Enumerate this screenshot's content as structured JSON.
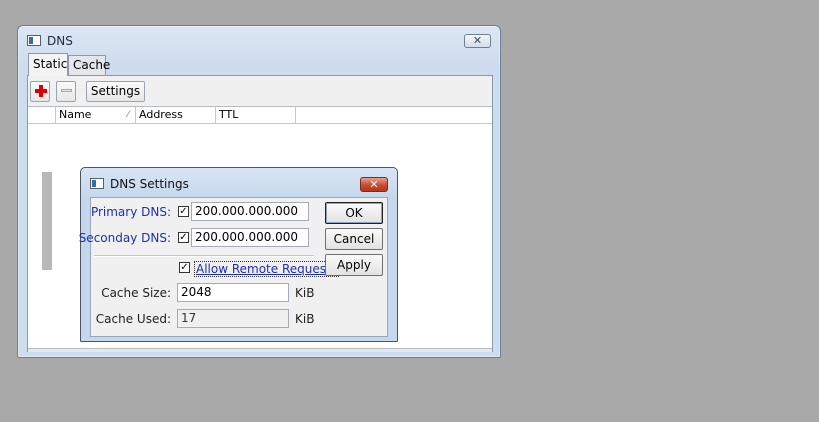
{
  "window": {
    "title": "DNS",
    "close_glyph": "✕",
    "tabs": [
      {
        "label": "Static"
      },
      {
        "label": "Cache"
      }
    ],
    "toolbar": {
      "add_icon": "plus-icon",
      "remove_icon": "minus-icon",
      "settings_label": "Settings"
    },
    "columns": [
      "Name",
      "Address",
      "TTL"
    ]
  },
  "dialog": {
    "title": "DNS Settings",
    "close_glyph": "✕",
    "primary_dns": {
      "label": "Primary DNS:",
      "value": "200.000.000.000",
      "checked": true
    },
    "secondary_dns": {
      "label": "Seconday DNS:",
      "value": "200.000.000.000",
      "checked": true
    },
    "allow_remote": {
      "label": "Allow Remote Requests",
      "checked": true
    },
    "cache_size": {
      "label": "Cache Size:",
      "value": "2048",
      "unit": "KiB"
    },
    "cache_used": {
      "label": "Cache Used:",
      "value": "17",
      "unit": "KiB"
    },
    "buttons": {
      "ok": "OK",
      "cancel": "Cancel",
      "apply": "Apply"
    },
    "check_glyph": "✓"
  },
  "colors": {
    "desktop": "#a9a9a9",
    "label_blue": "#1f2fa8",
    "close_red": "#c64b32"
  }
}
